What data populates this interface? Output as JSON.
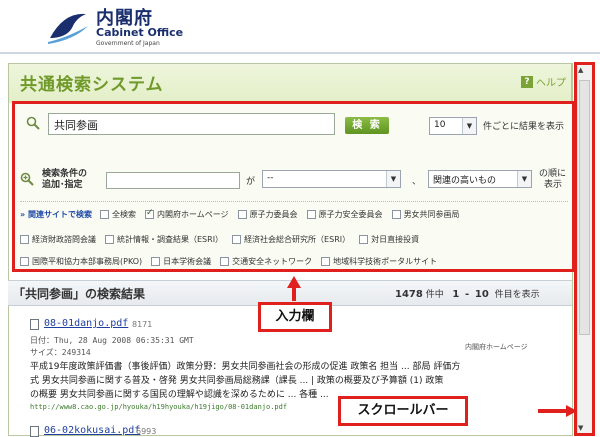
{
  "header": {
    "logo_jp": "内閣府",
    "logo_en": "Cabinet Office",
    "logo_sub": "Government of Japan"
  },
  "system": {
    "title": "共通検索システム",
    "help_label": "ヘルプ"
  },
  "search": {
    "query_value": "共同参画",
    "search_button": "検 索",
    "per_page_value": "10",
    "per_page_label": "件ごとに結果を表示",
    "condition_label_1": "検索条件の",
    "condition_label_2": "追加･指定",
    "ga_label": "が",
    "field_select_value": "--",
    "separator": "、",
    "sort_select_value": "関連の高いもの",
    "order_label_1": "の順に",
    "order_label_2": "表示"
  },
  "sites": {
    "related_label": "関連サイトで検索",
    "row1": [
      {
        "label": "全検索",
        "checked": false
      },
      {
        "label": "内閣府ホームページ",
        "checked": true
      },
      {
        "label": "原子力委員会",
        "checked": false
      },
      {
        "label": "原子力安全委員会",
        "checked": false
      },
      {
        "label": "男女共同参画局",
        "checked": false
      }
    ],
    "row2": [
      {
        "label": "経済財政諮問会議",
        "checked": false
      },
      {
        "label": "統計情報・調査結果（ESRI）",
        "checked": false
      },
      {
        "label": "経済社会総合研究所（ESRI）",
        "checked": false
      },
      {
        "label": "対日直接投資",
        "checked": false
      }
    ],
    "row3": [
      {
        "label": "国際平和協力本部事務局(PKO)",
        "checked": false
      },
      {
        "label": "日本学術会議",
        "checked": false
      },
      {
        "label": "交通安全ネットワーク",
        "checked": false
      },
      {
        "label": "地域科学技術ポータルサイト",
        "checked": false
      }
    ]
  },
  "results": {
    "title": "「共同参画」の検索結果",
    "total": "1478",
    "total_suffix": "件中",
    "range_from": "1",
    "range_dash": "-",
    "range_to": "10",
    "range_suffix": "件目を表示",
    "items": [
      {
        "link": "08-01danjo.pdf",
        "num": "8171",
        "date": "日付：Thu, 28 Aug 2008 06:35:31 GMT",
        "size": "サイズ：249314",
        "source": "内閣府ホームページ",
        "snippet1": "平成19年度政策評価書（事後評価）政策分野：男女共同参画社会の形成の促進 政策名 担当 ... 部局 評価方",
        "snippet2": "式 男女共同参画に関する普及・啓発 男女共同参画局総務課（課長 ... | 政策の概要及び予算額 (1) 政策",
        "snippet3": "の概要 男女共同参画に関する国民の理解や認識を深めるために ... 各種 ...",
        "url": "http://www8.cao.go.jp/hyouka/h19hyouka/h19jigo/08-01danjo.pdf"
      },
      {
        "link": "06-02kokusai.pdf",
        "num": "6993"
      }
    ]
  },
  "annotations": {
    "input_area": "入力欄",
    "scrollbar": "スクロールバー"
  },
  "colors": {
    "brand": "#6f9a2a",
    "annotation": "#e0201d",
    "link": "#1f3fa0"
  }
}
